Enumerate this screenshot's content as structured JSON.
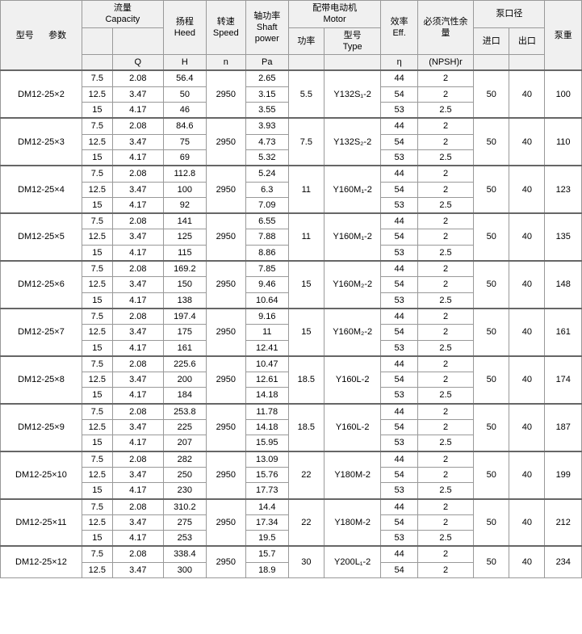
{
  "headers": {
    "col1": {
      "main": "型号",
      "sub": "参数"
    },
    "col2": {
      "main": "流量",
      "sub": "Capacity",
      "unit": "Q"
    },
    "col3": {
      "main": "扬程",
      "sub": "Heed",
      "unit": "H"
    },
    "col4": {
      "main": "转速",
      "sub": "Speed",
      "unit": "n"
    },
    "col5": {
      "main": "轴功率",
      "sub": "Shaft power",
      "unit": "Pa"
    },
    "col6_rate": {
      "main": "配带电动机",
      "sub": "Motor",
      "sub2": "功率"
    },
    "col6_type": {
      "sub": "型号",
      "sub2": "Type"
    },
    "col7": {
      "main": "效率",
      "sub": "Eff.",
      "unit": "η"
    },
    "col8": {
      "main": "必须汽性余量",
      "unit": "(NPSH)r"
    },
    "col9_in": {
      "main": "泵口径",
      "sub": "进口"
    },
    "col9_out": {
      "sub": "出口"
    },
    "col10": {
      "main": "泵重"
    }
  },
  "rows": [
    {
      "model": "DM12-25×2",
      "data": [
        {
          "q": "7.5",
          "h": "2.08",
          "head": "56.4",
          "n": "2950",
          "pa": "2.65",
          "rate": "5.5",
          "type": "Y132S₁-2",
          "eff": "44",
          "npsh": "2",
          "in": "50",
          "out": "40",
          "weight": "100"
        },
        {
          "q": "12.5",
          "h": "3.47",
          "head": "50",
          "pa": "3.15",
          "eff": "54",
          "npsh": "2"
        },
        {
          "q": "15",
          "h": "4.17",
          "head": "46",
          "pa": "3.55",
          "eff": "53",
          "npsh": "2.5"
        }
      ]
    },
    {
      "model": "DM12-25×3",
      "data": [
        {
          "q": "7.5",
          "h": "2.08",
          "head": "84.6",
          "n": "2950",
          "pa": "3.93",
          "rate": "7.5",
          "type": "Y132S₂-2",
          "eff": "44",
          "npsh": "2",
          "in": "50",
          "out": "40",
          "weight": "110"
        },
        {
          "q": "12.5",
          "h": "3.47",
          "head": "75",
          "pa": "4.73",
          "eff": "54",
          "npsh": "2"
        },
        {
          "q": "15",
          "h": "4.17",
          "head": "69",
          "pa": "5.32",
          "eff": "53",
          "npsh": "2.5"
        }
      ]
    },
    {
      "model": "DM12-25×4",
      "data": [
        {
          "q": "7.5",
          "h": "2.08",
          "head": "112.8",
          "n": "2950",
          "pa": "5.24",
          "rate": "11",
          "type": "Y160M₁-2",
          "eff": "44",
          "npsh": "2",
          "in": "50",
          "out": "40",
          "weight": "123"
        },
        {
          "q": "12.5",
          "h": "3.47",
          "head": "100",
          "pa": "6.3",
          "eff": "54",
          "npsh": "2"
        },
        {
          "q": "15",
          "h": "4.17",
          "head": "92",
          "pa": "7.09",
          "eff": "53",
          "npsh": "2.5"
        }
      ]
    },
    {
      "model": "DM12-25×5",
      "data": [
        {
          "q": "7.5",
          "h": "2.08",
          "head": "141",
          "n": "2950",
          "pa": "6.55",
          "rate": "11",
          "type": "Y160M₁-2",
          "eff": "44",
          "npsh": "2",
          "in": "50",
          "out": "40",
          "weight": "135"
        },
        {
          "q": "12.5",
          "h": "3.47",
          "head": "125",
          "pa": "7.88",
          "eff": "54",
          "npsh": "2"
        },
        {
          "q": "15",
          "h": "4.17",
          "head": "115",
          "pa": "8.86",
          "eff": "53",
          "npsh": "2.5"
        }
      ]
    },
    {
      "model": "DM12-25×6",
      "data": [
        {
          "q": "7.5",
          "h": "2.08",
          "head": "169.2",
          "n": "2950",
          "pa": "7.85",
          "rate": "15",
          "type": "Y160M₂-2",
          "eff": "44",
          "npsh": "2",
          "in": "50",
          "out": "40",
          "weight": "148"
        },
        {
          "q": "12.5",
          "h": "3.47",
          "head": "150",
          "pa": "9.46",
          "eff": "54",
          "npsh": "2"
        },
        {
          "q": "15",
          "h": "4.17",
          "head": "138",
          "pa": "10.64",
          "eff": "53",
          "npsh": "2.5"
        }
      ]
    },
    {
      "model": "DM12-25×7",
      "data": [
        {
          "q": "7.5",
          "h": "2.08",
          "head": "197.4",
          "n": "2950",
          "pa": "9.16",
          "rate": "15",
          "type": "Y160M₂-2",
          "eff": "44",
          "npsh": "2",
          "in": "50",
          "out": "40",
          "weight": "161"
        },
        {
          "q": "12.5",
          "h": "3.47",
          "head": "175",
          "pa": "11",
          "eff": "54",
          "npsh": "2"
        },
        {
          "q": "15",
          "h": "4.17",
          "head": "161",
          "pa": "12.41",
          "eff": "53",
          "npsh": "2.5"
        }
      ]
    },
    {
      "model": "DM12-25×8",
      "data": [
        {
          "q": "7.5",
          "h": "2.08",
          "head": "225.6",
          "n": "2950",
          "pa": "10.47",
          "rate": "18.5",
          "type": "Y160L-2",
          "eff": "44",
          "npsh": "2",
          "in": "50",
          "out": "40",
          "weight": "174"
        },
        {
          "q": "12.5",
          "h": "3.47",
          "head": "200",
          "pa": "12.61",
          "eff": "54",
          "npsh": "2"
        },
        {
          "q": "15",
          "h": "4.17",
          "head": "184",
          "pa": "14.18",
          "eff": "53",
          "npsh": "2.5"
        }
      ]
    },
    {
      "model": "DM12-25×9",
      "data": [
        {
          "q": "7.5",
          "h": "2.08",
          "head": "253.8",
          "n": "2950",
          "pa": "11.78",
          "rate": "18.5",
          "type": "Y160L-2",
          "eff": "44",
          "npsh": "2",
          "in": "50",
          "out": "40",
          "weight": "187"
        },
        {
          "q": "12.5",
          "h": "3.47",
          "head": "225",
          "pa": "14.18",
          "eff": "54",
          "npsh": "2"
        },
        {
          "q": "15",
          "h": "4.17",
          "head": "207",
          "pa": "15.95",
          "eff": "53",
          "npsh": "2.5"
        }
      ]
    },
    {
      "model": "DM12-25×10",
      "data": [
        {
          "q": "7.5",
          "h": "2.08",
          "head": "282",
          "n": "2950",
          "pa": "13.09",
          "rate": "22",
          "type": "Y180M-2",
          "eff": "44",
          "npsh": "2",
          "in": "50",
          "out": "40",
          "weight": "199"
        },
        {
          "q": "12.5",
          "h": "3.47",
          "head": "250",
          "pa": "15.76",
          "eff": "54",
          "npsh": "2"
        },
        {
          "q": "15",
          "h": "4.17",
          "head": "230",
          "pa": "17.73",
          "eff": "53",
          "npsh": "2.5"
        }
      ]
    },
    {
      "model": "DM12-25×11",
      "data": [
        {
          "q": "7.5",
          "h": "2.08",
          "head": "310.2",
          "n": "2950",
          "pa": "14.4",
          "rate": "22",
          "type": "Y180M-2",
          "eff": "44",
          "npsh": "2",
          "in": "50",
          "out": "40",
          "weight": "212"
        },
        {
          "q": "12.5",
          "h": "3.47",
          "head": "275",
          "pa": "17.34",
          "eff": "54",
          "npsh": "2"
        },
        {
          "q": "15",
          "h": "4.17",
          "head": "253",
          "pa": "19.5",
          "eff": "53",
          "npsh": "2.5"
        }
      ]
    },
    {
      "model": "DM12-25×12",
      "data": [
        {
          "q": "7.5",
          "h": "2.08",
          "head": "338.4",
          "n": "2950",
          "pa": "15.7",
          "rate": "30",
          "type": "Y200L₁-2",
          "eff": "44",
          "npsh": "2",
          "in": "50",
          "out": "40",
          "weight": "234"
        },
        {
          "q": "12.5",
          "h": "3.47",
          "head": "300",
          "pa": "18.9",
          "eff": "54",
          "npsh": "2"
        }
      ]
    }
  ]
}
